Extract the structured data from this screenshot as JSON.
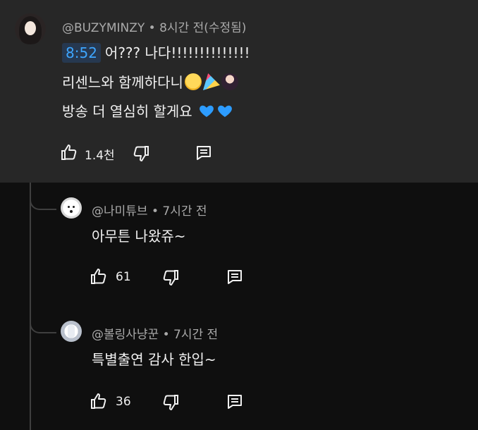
{
  "colors": {
    "background": "#0f0f0f",
    "main_comment_bg": "#272727",
    "text_primary": "#f1f1f1",
    "text_secondary": "#aaaaaa",
    "timestamp_text": "#3ea6ff",
    "timestamp_bg": "#263850",
    "thread_line": "#3f3f3f",
    "heart_blue": "#2d9cff"
  },
  "main_comment": {
    "author_meta": "@BUZYMINZY • 8시간 전(수정됨)",
    "timestamp_link": "8:52",
    "line1_text": "어??? 나다!!!!!!!!!!!!!!",
    "line2_text": "리센느와 함께하다니",
    "line3_text": "방송 더 열심히 할게요",
    "line2_emojis": [
      "pleading-face-emoji",
      "party-popper-emoji",
      "person-emoji"
    ],
    "line3_emojis": [
      "blue-heart-emoji",
      "blue-heart-emoji"
    ],
    "like_count": "1.4천"
  },
  "replies": [
    {
      "author_meta": "@나미튜브 • 7시간 전",
      "text": "아무튼 나왔쥬~",
      "like_count": "61"
    },
    {
      "author_meta": "@볼링사냥꾼 • 7시간 전",
      "text": "특별출연 감사 한입~",
      "like_count": "36"
    }
  ],
  "icons": {
    "like": "thumb-up-icon",
    "dislike": "thumb-down-icon",
    "reply": "comment-reply-icon"
  }
}
